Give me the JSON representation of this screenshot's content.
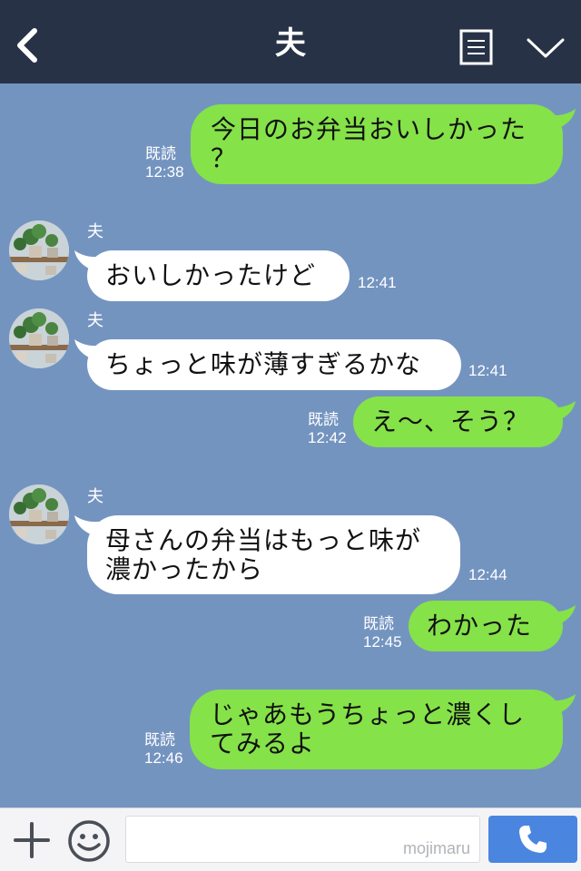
{
  "header": {
    "title": "夫"
  },
  "messages": [
    {
      "dir": "out",
      "lines": [
        "今日のお弁当おいしかった",
        "？"
      ],
      "read": "既読",
      "time": "12:38"
    },
    {
      "dir": "in",
      "sender": "夫",
      "lines": [
        "おいしかったけど"
      ],
      "time": "12:41"
    },
    {
      "dir": "in",
      "sender": "夫",
      "lines": [
        "ちょっと味が薄すぎるかな"
      ],
      "time": "12:41"
    },
    {
      "dir": "out",
      "lines": [
        "え〜、そう？"
      ],
      "read": "既読",
      "time": "12:42"
    },
    {
      "dir": "in",
      "sender": "夫",
      "lines": [
        "母さんの弁当はもっと味が",
        "濃かったから"
      ],
      "time": "12:44"
    },
    {
      "dir": "out",
      "lines": [
        "わかった"
      ],
      "read": "既読",
      "time": "12:45"
    },
    {
      "dir": "out",
      "lines": [
        "じゃあもうちょっと濃くし",
        "てみるよ"
      ],
      "read": "既読",
      "time": "12:46"
    }
  ],
  "inputbar": {
    "watermark": "mojimaru"
  },
  "icons": {
    "back": "back-arrow-icon",
    "menu": "menu-list-icon",
    "chevron": "chevron-down-icon",
    "plus": "plus-icon",
    "smile": "smile-icon",
    "call": "phone-icon"
  },
  "colors": {
    "header_bg": "#273246",
    "chat_bg": "#7494c0",
    "outgoing_bubble": "#85e249",
    "incoming_bubble": "#ffffff",
    "call_button": "#4a86e0"
  }
}
